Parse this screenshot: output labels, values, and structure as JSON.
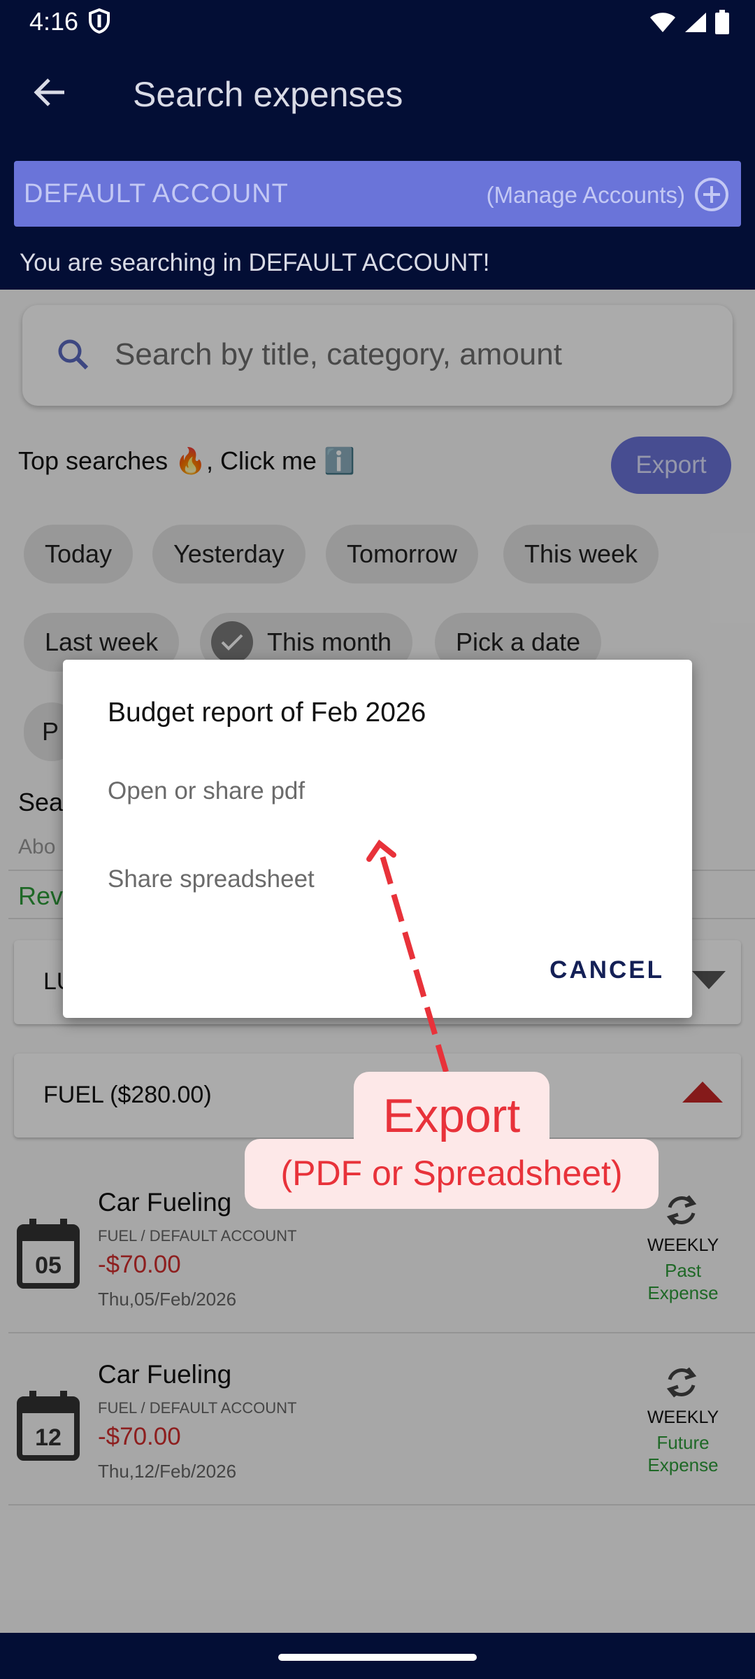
{
  "status": {
    "time": "4:16"
  },
  "app_bar": {
    "title": "Search expenses",
    "account_name": "DEFAULT ACCOUNT",
    "manage_accounts": "(Manage Accounts)",
    "searching_message": "You are searching in DEFAULT ACCOUNT!"
  },
  "search": {
    "placeholder": "Search by title, category, amount"
  },
  "top_searches": {
    "label": "Top searches 🔥, Click me ℹ️",
    "export_label": "Export"
  },
  "chips": [
    "Today",
    "Yesterday",
    "Tomorrow",
    "This week",
    "Last week",
    "This month",
    "Pick a date",
    "P"
  ],
  "hidden_rows": {
    "sea": "Sea",
    "abo": "Abo",
    "rev": "Rev",
    "lu": "LU"
  },
  "category_card": {
    "label": "FUEL ($280.00)"
  },
  "expenses": [
    {
      "title": "Car Fueling",
      "subtitle": "FUEL / DEFAULT ACCOUNT",
      "amount": "-$70.00",
      "date": "Thu,05/Feb/2026",
      "day": "05",
      "repeat": "WEEKLY",
      "status": "Past Expense"
    },
    {
      "title": "Car Fueling",
      "subtitle": "FUEL / DEFAULT ACCOUNT",
      "amount": "-$70.00",
      "date": "Thu,12/Feb/2026",
      "day": "12",
      "repeat": "WEEKLY",
      "status": "Future Expense"
    }
  ],
  "dialog": {
    "title": "Budget report of Feb 2026",
    "option_pdf": "Open or share pdf",
    "option_spreadsheet": "Share spreadsheet",
    "cancel": "CANCEL"
  },
  "annotation": {
    "line1": "Export",
    "line2": "(PDF or Spreadsheet)"
  },
  "colors": {
    "primary_dark": "#030e35",
    "accent": "#6a74d9",
    "expense_red": "#d32f2f",
    "status_green": "#2e9b3a",
    "annotation_red": "#e8323a"
  }
}
